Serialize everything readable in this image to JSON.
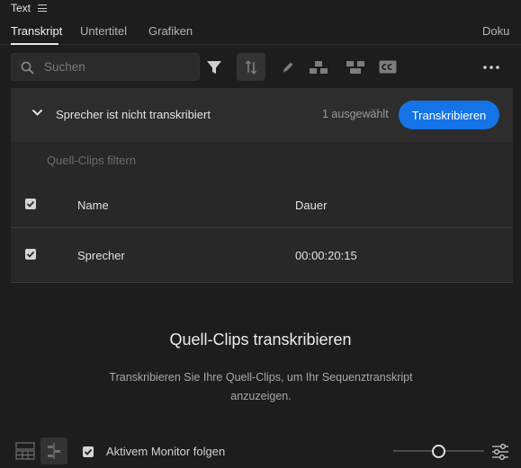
{
  "panel": {
    "title": "Text"
  },
  "tabs": [
    {
      "label": "Transkript",
      "active": true
    },
    {
      "label": "Untertitel",
      "active": false
    },
    {
      "label": "Grafiken",
      "active": false
    },
    {
      "label": "Doku",
      "active": false
    }
  ],
  "toolbar": {
    "search_placeholder": "Suchen",
    "icons": [
      "filter-icon",
      "transcript-sync-icon",
      "pencil-icon",
      "split-clip-icon",
      "merge-clip-icon",
      "closed-captions-icon",
      "more-icon"
    ]
  },
  "transcribe": {
    "header": "Sprecher ist nicht transkribiert",
    "selected_count": "1 ausgewählt",
    "button": "Transkribieren",
    "filter_placeholder": "Quell-Clips filtern",
    "columns": {
      "name": "Name",
      "duration": "Dauer"
    },
    "rows": [
      {
        "name": "Sprecher",
        "duration": "00:00:20:15",
        "checked": true
      }
    ]
  },
  "empty_state": {
    "title": "Quell-Clips transkribieren",
    "description": "Transkribieren Sie Ihre Quell-Clips, um Ihr Sequenztranskript anzuzeigen."
  },
  "footer": {
    "follow_monitor_label": "Aktivem Monitor folgen",
    "follow_monitor_checked": true,
    "zoom_level": 0.5
  },
  "colors": {
    "accent": "#1473e6",
    "background": "#1d1d1d",
    "panel": "#282828"
  }
}
